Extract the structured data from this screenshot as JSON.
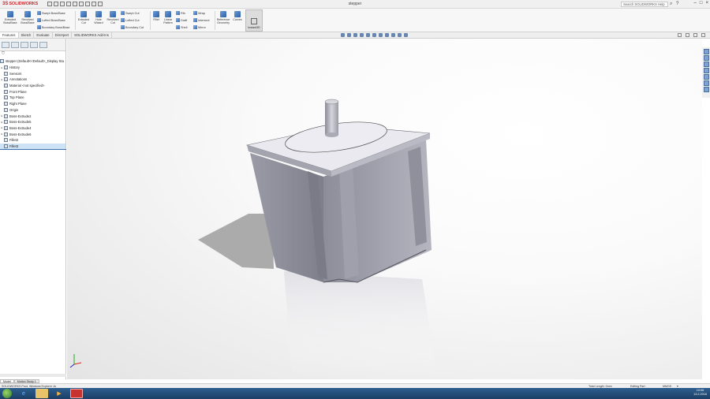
{
  "app": {
    "logo_ds": "3S",
    "logo_text": "SOLIDWORKS",
    "window_title": "stepper",
    "search_placeholder": "Search SOLIDWORKS Help"
  },
  "ribbon": {
    "extruded_boss": "Extruded Boss/Base",
    "revolved_boss": "Revolved Boss/Base",
    "swept_boss": "Swept Boss/Base",
    "lofted_boss": "Lofted Boss/Base",
    "boundary_boss": "Boundary Boss/Base",
    "extruded_cut": "Extruded Cut",
    "hole_wizard": "Hole Wizard",
    "revolved_cut": "Revolved Cut",
    "swept_cut": "Swept Cut",
    "lofted_cut": "Lofted Cut",
    "boundary_cut": "Boundary Cut",
    "fillet": "Fillet",
    "linear_pattern": "Linear Pattern",
    "rib": "Rib",
    "draft": "Draft",
    "shell": "Shell",
    "wrap": "Wrap",
    "intersect": "Intersect",
    "mirror": "Mirror",
    "reference_geometry": "Reference Geometry",
    "curves": "Curves",
    "instant3d": "Instant3D"
  },
  "tabs": [
    "Features",
    "Sketch",
    "Evaluate",
    "DimXpert",
    "SOLIDWORKS Add-Ins"
  ],
  "feature_tree": {
    "root": "stepper  (Default<<Default>_Display Sta",
    "items": [
      {
        "label": "History",
        "expand": "▸"
      },
      {
        "label": "Sensors",
        "expand": ""
      },
      {
        "label": "Annotations",
        "expand": "▸"
      },
      {
        "label": "Material <not specified>",
        "expand": ""
      },
      {
        "label": "Front Plane",
        "expand": ""
      },
      {
        "label": "Top Plane",
        "expand": ""
      },
      {
        "label": "Right Plane",
        "expand": ""
      },
      {
        "label": "Origin",
        "expand": ""
      },
      {
        "label": "Boss-Extrude2",
        "expand": "▸"
      },
      {
        "label": "Boss-Extrude5",
        "expand": "▸"
      },
      {
        "label": "Boss-Extrude4",
        "expand": "▸"
      },
      {
        "label": "Boss-Extrude6",
        "expand": "▸"
      },
      {
        "label": "Fillet2",
        "expand": ""
      },
      {
        "label": "Fillet3",
        "expand": ""
      }
    ]
  },
  "bottom_tabs": [
    "Model",
    "Motion Study 1"
  ],
  "status": {
    "left": "SOLIDWORKS Prod. Windows Explorer Ja",
    "total_length": "Total Length: 0mm",
    "mode": "Editing Part",
    "units": "MMGS",
    "arrow": "▾"
  },
  "taskbar": {
    "time": "10:06",
    "date": "13.2.2016"
  },
  "colors": {
    "accent": "#d8232a",
    "taskbar": "#1b3f66",
    "selection": "#cfe3f7"
  }
}
